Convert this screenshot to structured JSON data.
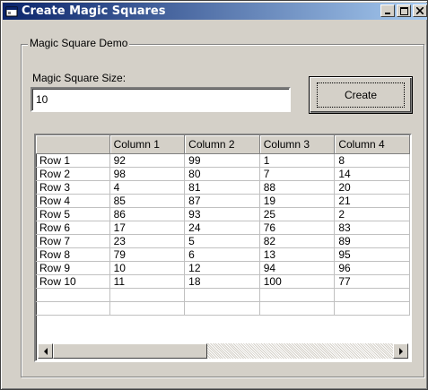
{
  "window": {
    "title": "Create Magic Squares"
  },
  "frame": {
    "label": "Magic Square Demo"
  },
  "size": {
    "label": "Magic Square Size:",
    "value": "10"
  },
  "create_button": {
    "label": "Create"
  },
  "grid": {
    "columns": [
      "",
      "Column 1",
      "Column 2",
      "Column 3",
      "Column 4"
    ],
    "rows": [
      [
        "Row 1",
        "92",
        "99",
        "1",
        "8"
      ],
      [
        "Row 2",
        "98",
        "80",
        "7",
        "14"
      ],
      [
        "Row 3",
        "4",
        "81",
        "88",
        "20"
      ],
      [
        "Row 4",
        "85",
        "87",
        "19",
        "21"
      ],
      [
        "Row 5",
        "86",
        "93",
        "25",
        "2"
      ],
      [
        "Row 6",
        "17",
        "24",
        "76",
        "83"
      ],
      [
        "Row 7",
        "23",
        "5",
        "82",
        "89"
      ],
      [
        "Row 8",
        "79",
        "6",
        "13",
        "95"
      ],
      [
        "Row 9",
        "10",
        "12",
        "94",
        "96"
      ],
      [
        "Row 10",
        "11",
        "18",
        "100",
        "77"
      ],
      [
        "",
        "",
        "",
        "",
        ""
      ],
      [
        "",
        "",
        "",
        "",
        ""
      ]
    ]
  },
  "icons": {
    "app": "window-app-icon",
    "minimize": "minimize-icon",
    "maximize": "maximize-icon",
    "close": "close-icon",
    "left": "scroll-left-arrow-icon",
    "right": "scroll-right-arrow-icon"
  }
}
